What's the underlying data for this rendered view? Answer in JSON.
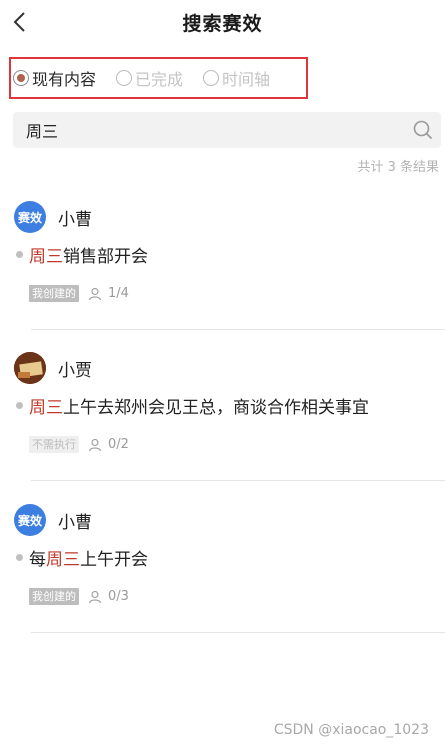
{
  "header": {
    "title": "搜索赛效"
  },
  "filters": [
    {
      "label": "现有内容",
      "selected": true
    },
    {
      "label": "已完成",
      "selected": false
    },
    {
      "label": "时间轴",
      "selected": false
    }
  ],
  "search": {
    "value": "周三"
  },
  "result_count": "共计 3 条结果",
  "results": [
    {
      "avatar_text": "赛效",
      "user": "小曹",
      "task_before": "",
      "task_highlight": "周三",
      "task_after": "销售部开会",
      "tag": "我创建的",
      "ratio": "1/4"
    },
    {
      "avatar_text": "",
      "user": "小贾",
      "task_before": "",
      "task_highlight": "周三",
      "task_after": "上午去郑州会见王总，商谈合作相关事宜",
      "tag": "不需执行",
      "ratio": "0/2"
    },
    {
      "avatar_text": "赛效",
      "user": "小曹",
      "task_before": "每",
      "task_highlight": "周三",
      "task_after": "上午开会",
      "tag": "我创建的",
      "ratio": "0/3"
    }
  ],
  "watermark": "CSDN @xiaocao_1023",
  "colors": {
    "highlight": "#c0392b",
    "brand_avatar": "#3d7fe0",
    "filter_border": "#e0353a"
  }
}
